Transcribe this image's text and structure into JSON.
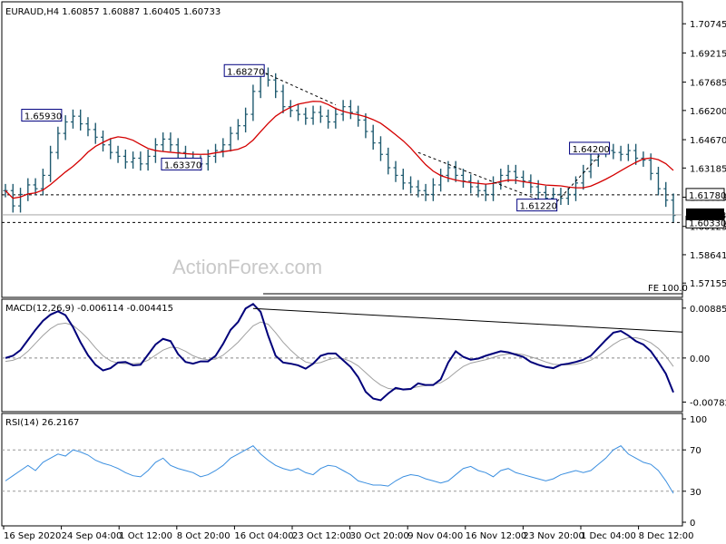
{
  "chart_data": [
    {
      "type": "candlestick",
      "panel": "price",
      "title": "EURAUD,H4  1.60857 1.60887 1.60405 1.60733",
      "ylim": [
        1.565,
        1.718
      ],
      "y_ticks": [
        "1.70745",
        "1.69215",
        "1.67685",
        "1.66200",
        "1.64670",
        "1.63185",
        "1.61655",
        "1.60125",
        "1.58641",
        "1.57155"
      ],
      "current_price_label": "1.60733",
      "current_price": 1.60733,
      "moving_average_color": "#d40000",
      "series_color": "#1f5a6f",
      "trendline_style": "dashed",
      "annotations": [
        {
          "label": "1.68270",
          "value": 1.6827
        },
        {
          "label": "1.65930",
          "value": 1.6593
        },
        {
          "label": "1.63370",
          "value": 1.6337
        },
        {
          "label": "1.64200",
          "value": 1.642
        },
        {
          "label": "1.61220",
          "value": 1.6122
        }
      ],
      "horizontal_levels": [
        {
          "label": "1.61780",
          "value": 1.6178,
          "style": "dashed"
        },
        {
          "label": "1.60330",
          "value": 1.6033,
          "style": "dashed"
        }
      ],
      "fe_label": "FE 100.0",
      "watermark": "ActionForex.com",
      "closes": [
        1.62,
        1.612,
        1.618,
        1.623,
        1.621,
        1.628,
        1.64,
        1.65,
        1.656,
        1.659,
        1.655,
        1.652,
        1.648,
        1.644,
        1.64,
        1.638,
        1.635,
        1.637,
        1.634,
        1.638,
        1.644,
        1.647,
        1.644,
        1.64,
        1.637,
        1.635,
        1.634,
        1.638,
        1.641,
        1.644,
        1.65,
        1.654,
        1.66,
        1.672,
        1.681,
        1.678,
        1.672,
        1.664,
        1.662,
        1.66,
        1.658,
        1.661,
        1.659,
        1.656,
        1.66,
        1.664,
        1.661,
        1.657,
        1.651,
        1.645,
        1.639,
        1.632,
        1.628,
        1.624,
        1.622,
        1.62,
        1.618,
        1.623,
        1.628,
        1.632,
        1.628,
        1.625,
        1.622,
        1.62,
        1.618,
        1.624,
        1.628,
        1.63,
        1.627,
        1.625,
        1.622,
        1.619,
        1.616,
        1.618,
        1.616,
        1.618,
        1.624,
        1.63,
        1.636,
        1.642,
        1.641,
        1.64,
        1.639,
        1.641,
        1.637,
        1.636,
        1.629,
        1.621,
        1.615,
        1.607
      ]
    },
    {
      "type": "line",
      "panel": "macd",
      "title": "MACD(12,26,9) -0.006114 -0.004415",
      "ylim": [
        -0.0092,
        0.0098
      ],
      "y_ticks": [
        "0.008859",
        "0.00",
        "-0.007826"
      ],
      "series": [
        {
          "name": "MACD",
          "color": "#00007a",
          "values": [
            0.0,
            0.0004,
            0.0014,
            0.0032,
            0.005,
            0.0066,
            0.0077,
            0.0083,
            0.0076,
            0.0055,
            0.0028,
            0.0005,
            -0.0012,
            -0.0022,
            -0.0018,
            -0.0008,
            -0.0007,
            -0.0013,
            -0.0012,
            0.0006,
            0.0024,
            0.0034,
            0.003,
            0.0007,
            -0.0007,
            -0.001,
            -0.0006,
            -0.0006,
            0.0004,
            0.0025,
            0.005,
            0.0064,
            0.0088,
            0.0096,
            0.0082,
            0.004,
            0.0004,
            -0.0008,
            -0.001,
            -0.0013,
            -0.0019,
            -0.001,
            0.0004,
            0.0008,
            0.0008,
            -0.0004,
            -0.0016,
            -0.0034,
            -0.006,
            -0.0072,
            -0.0075,
            -0.0063,
            -0.0053,
            -0.0056,
            -0.0055,
            -0.0045,
            -0.0048,
            -0.0048,
            -0.0038,
            -0.0008,
            0.0012,
            0.0002,
            -0.0003,
            -0.0001,
            0.0004,
            0.0008,
            0.0012,
            0.001,
            0.0006,
            0.0002,
            -0.0007,
            -0.0012,
            -0.0016,
            -0.0018,
            -0.0012,
            -0.001,
            -0.0007,
            -0.0003,
            0.0004,
            0.0018,
            0.0032,
            0.0045,
            0.0048,
            0.004,
            0.003,
            0.0024,
            0.0012,
            -0.0007,
            -0.0028,
            -0.0061
          ]
        },
        {
          "name": "Signal",
          "color": "#a0a0a0",
          "values": [
            -0.0006,
            -0.0004,
            0.0001,
            0.0012,
            0.0026,
            0.004,
            0.0052,
            0.006,
            0.0062,
            0.0058,
            0.0047,
            0.0034,
            0.0018,
            0.0004,
            -0.0005,
            -0.0009,
            -0.001,
            -0.001,
            -0.0009,
            -0.0004,
            0.0005,
            0.0014,
            0.0019,
            0.0018,
            0.0012,
            0.0004,
            -0.0001,
            -0.0003,
            -0.0002,
            0.0005,
            0.0016,
            0.0028,
            0.0043,
            0.0057,
            0.0064,
            0.006,
            0.0045,
            0.0028,
            0.0014,
            0.0002,
            -0.0007,
            -0.001,
            -0.0008,
            -0.0003,
            0.0,
            -0.0001,
            -0.0006,
            -0.0014,
            -0.0026,
            -0.0038,
            -0.0048,
            -0.0054,
            -0.0056,
            -0.0055,
            -0.0054,
            -0.0051,
            -0.0049,
            -0.0047,
            -0.0044,
            -0.0036,
            -0.0025,
            -0.0015,
            -0.0009,
            -0.0006,
            -0.0003,
            0.0001,
            0.0005,
            0.0007,
            0.0008,
            0.0006,
            0.0002,
            -0.0002,
            -0.0007,
            -0.0011,
            -0.0012,
            -0.0012,
            -0.0011,
            -0.0008,
            -0.0004,
            0.0004,
            0.0014,
            0.0024,
            0.0032,
            0.0036,
            0.0036,
            0.0033,
            0.0027,
            0.0017,
            0.0003,
            -0.0015
          ]
        }
      ],
      "trendline_value_start": 0.0088,
      "trendline_value_end": 0.0046
    },
    {
      "type": "line",
      "panel": "rsi",
      "title": "RSI(14) 26.2167",
      "ylim": [
        0,
        100
      ],
      "y_ticks": [
        "100",
        "70",
        "30",
        "0"
      ],
      "reference_levels": [
        70,
        30
      ],
      "series": [
        {
          "name": "RSI",
          "color": "#3b8fe0",
          "values": [
            40,
            45,
            50,
            55,
            50,
            58,
            62,
            66,
            64,
            70,
            68,
            65,
            60,
            57,
            55,
            52,
            48,
            45,
            44,
            50,
            58,
            62,
            55,
            52,
            50,
            48,
            44,
            46,
            50,
            55,
            62,
            66,
            70,
            74,
            66,
            60,
            55,
            52,
            50,
            52,
            48,
            46,
            52,
            55,
            54,
            50,
            46,
            40,
            38,
            36,
            36,
            35,
            40,
            44,
            46,
            45,
            42,
            40,
            38,
            40,
            46,
            52,
            54,
            50,
            48,
            44,
            50,
            52,
            48,
            46,
            44,
            42,
            40,
            42,
            46,
            48,
            50,
            48,
            50,
            56,
            62,
            70,
            74,
            66,
            62,
            58,
            56,
            50,
            40,
            28
          ]
        }
      ]
    }
  ],
  "x_axis_labels": [
    "16 Sep 2020",
    "24 Sep 04:00",
    "1 Oct 12:00",
    "8 Oct 20:00",
    "16 Oct 04:00",
    "23 Oct 12:00",
    "30 Oct 20:00",
    "9 Nov 04:00",
    "16 Nov 12:00",
    "23 Nov 20:00",
    "1 Dec 04:00",
    "8 Dec 12:00"
  ],
  "colors": {
    "background": "#ffffff",
    "grid": "#000000",
    "price_bar": "#1f5a6f",
    "current_price_bg": "#000000",
    "annotation_border": "#000080"
  }
}
